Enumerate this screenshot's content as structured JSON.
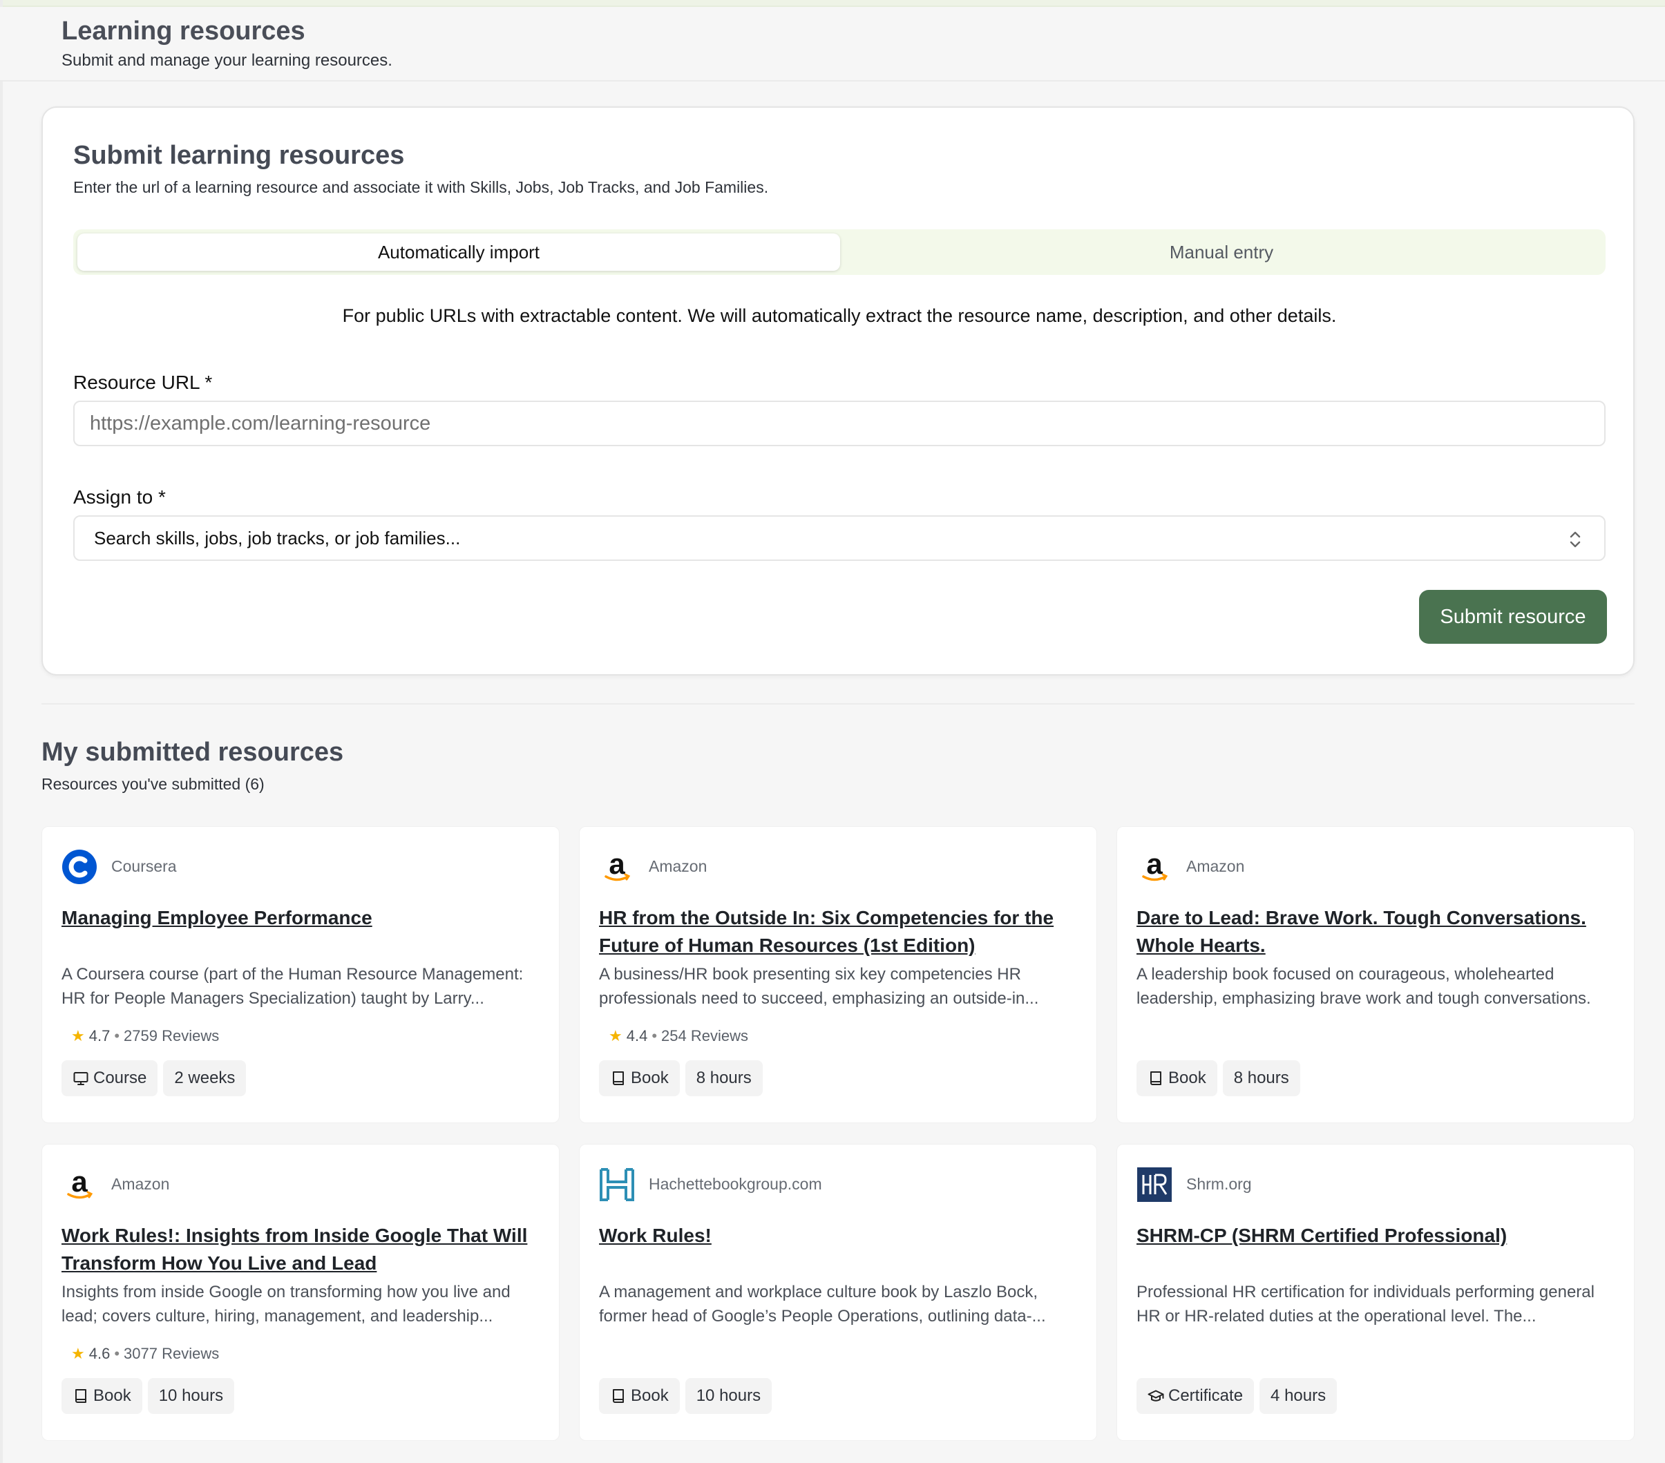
{
  "page": {
    "title": "Learning resources",
    "subtitle": "Submit and manage your learning resources."
  },
  "submit": {
    "title": "Submit learning resources",
    "description": "Enter the url of a learning resource and associate it with Skills, Jobs, Job Tracks, and Job Families.",
    "tabs": [
      {
        "label": "Automatically import",
        "active": true
      },
      {
        "label": "Manual entry",
        "active": false
      }
    ],
    "import_note": "For public URLs with extractable content. We will automatically extract the resource name, description, and other details.",
    "url_label": "Resource URL *",
    "url_placeholder": "https://example.com/learning-resource",
    "assign_label": "Assign to *",
    "assign_placeholder": "Search skills, jobs, job tracks, or job families...",
    "button_label": "Submit resource",
    "accent_color": "#4a7350"
  },
  "submitted": {
    "title": "My submitted resources",
    "subtitle": "Resources you've submitted (6)",
    "resources": [
      {
        "provider": "Coursera",
        "logo": "coursera-logo",
        "title": "Managing Employee Performance",
        "description": "A Coursera course (part of the Human Resource Management: HR for People Managers Specialization) taught by Larry...",
        "rating": "4.7",
        "reviews": "2759 Reviews",
        "type": "Course",
        "type_icon": "monitor-icon",
        "duration": "2 weeks"
      },
      {
        "provider": "Amazon",
        "logo": "amazon-logo",
        "title": "HR from the Outside In: Six Competencies for the Future of Human Resources (1st Edition)",
        "description": "A business/HR book presenting six key competencies HR professionals need to succeed, emphasizing an outside-in...",
        "rating": "4.4",
        "reviews": "254 Reviews",
        "type": "Book",
        "type_icon": "book-icon",
        "duration": "8 hours"
      },
      {
        "provider": "Amazon",
        "logo": "amazon-logo",
        "title": "Dare to Lead: Brave Work. Tough Conversations. Whole Hearts.",
        "description": "A leadership book focused on courageous, wholehearted leadership, emphasizing brave work and tough conversations.",
        "rating": "",
        "reviews": "",
        "type": "Book",
        "type_icon": "book-icon",
        "duration": "8 hours"
      },
      {
        "provider": "Amazon",
        "logo": "amazon-logo",
        "title": "Work Rules!: Insights from Inside Google That Will Transform How You Live and Lead",
        "description": "Insights from inside Google on transforming how you live and lead; covers culture, hiring, management, and leadership...",
        "rating": "4.6",
        "reviews": "3077 Reviews",
        "type": "Book",
        "type_icon": "book-icon",
        "duration": "10 hours"
      },
      {
        "provider": "Hachettebookgroup.com",
        "logo": "hachette-logo",
        "title": "Work Rules!",
        "description": "A management and workplace culture book by Laszlo Bock, former head of Google’s People Operations, outlining data-...",
        "rating": "",
        "reviews": "",
        "type": "Book",
        "type_icon": "book-icon",
        "duration": "10 hours"
      },
      {
        "provider": "Shrm.org",
        "logo": "shrm-logo",
        "title": "SHRM-CP (SHRM Certified Professional)",
        "description": "Professional HR certification for individuals performing general HR or HR-related duties at the operational level. The...",
        "rating": "",
        "reviews": "",
        "type": "Certificate",
        "type_icon": "graduation-cap-icon",
        "duration": "4 hours"
      }
    ]
  }
}
